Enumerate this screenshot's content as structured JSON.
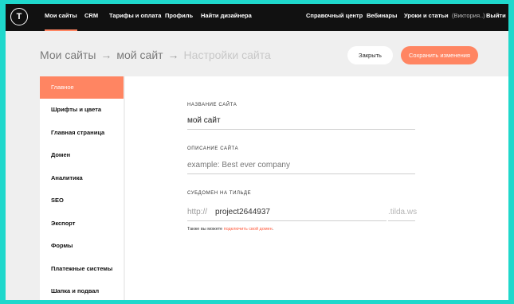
{
  "topnav": {
    "logo_letter": "T",
    "left_links": [
      "Мои сайты",
      "CRM",
      "Тарифы и оплата",
      "Профиль",
      "Найти дизайнера"
    ],
    "right_links": [
      "Справочный центр",
      "Вебинары",
      "Уроки и статьи"
    ],
    "user": "(Виктория..)",
    "logout": "Выйти"
  },
  "breadcrumb": {
    "items": [
      "Мои сайты",
      "мой сайт",
      "Настройки сайта"
    ],
    "separator": "→"
  },
  "actions": {
    "close_label": "Закрыть",
    "save_label": "Сохранить изменения"
  },
  "sidebar": {
    "items": [
      {
        "label": "Главное",
        "active": true
      },
      {
        "label": "Шрифты и цвета"
      },
      {
        "label": "Главная страница"
      },
      {
        "label": "Домен"
      },
      {
        "label": "Аналитика"
      },
      {
        "label": "SEO"
      },
      {
        "label": "Экспорт"
      },
      {
        "label": "Формы"
      },
      {
        "label": "Платежные системы"
      },
      {
        "label": "Шапка и подвал"
      }
    ]
  },
  "form": {
    "site_name": {
      "label": "НАЗВАНИЕ САЙТА",
      "value": "мой сайт"
    },
    "site_description": {
      "label": "ОПИСАНИЕ САЙТА",
      "placeholder": "example: Best ever company"
    },
    "subdomain": {
      "label": "СУБДОМЕН НА ТИЛЬДЕ",
      "prefix": "http://",
      "value": "project2644937",
      "suffix": ".tilda.ws"
    },
    "note_text": "Также вы можете ",
    "note_link": "подключить свой домен",
    "note_end": "."
  },
  "colors": {
    "accent": "#ff8562",
    "topbar": "#111111",
    "background": "#efefef",
    "border_teal": "#1fd8cc"
  }
}
